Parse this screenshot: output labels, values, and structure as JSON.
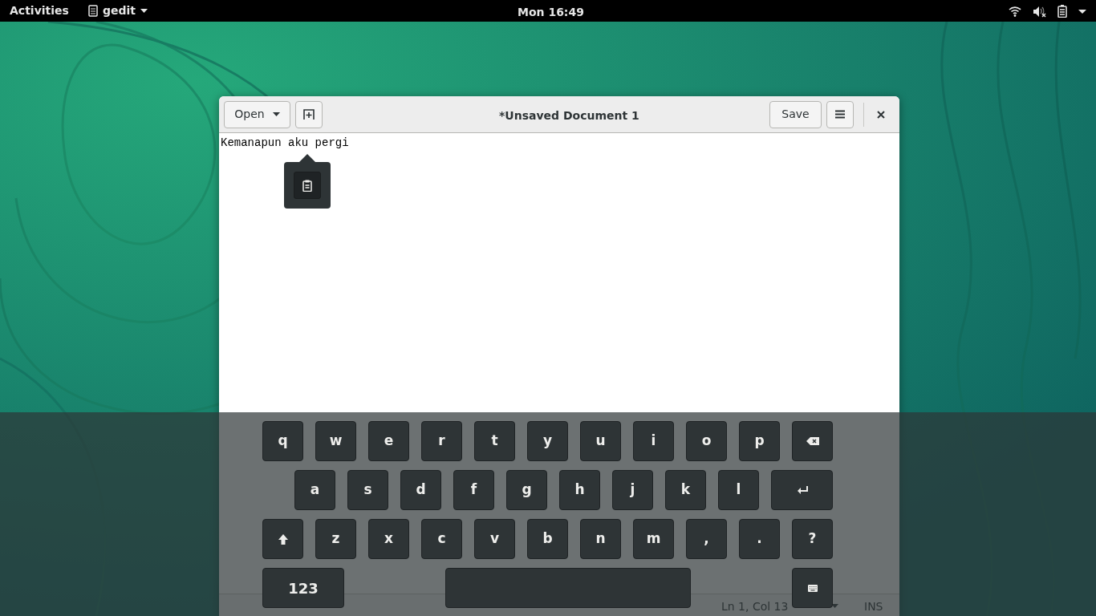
{
  "top_bar": {
    "activities": "Activities",
    "app_menu": "gedit",
    "clock": "Mon 16:49"
  },
  "window": {
    "open_button": "Open",
    "title": "*Unsaved Document 1",
    "save_button": "Save",
    "text": "Kemanapun aku pergi",
    "status_bar": {
      "position": "Ln 1, Col 13",
      "mode": "INS"
    }
  },
  "keyboard": {
    "rows": [
      [
        {
          "kind": "letter",
          "label": "q"
        },
        {
          "kind": "letter",
          "label": "w"
        },
        {
          "kind": "letter",
          "label": "e"
        },
        {
          "kind": "letter",
          "label": "r"
        },
        {
          "kind": "letter",
          "label": "t"
        },
        {
          "kind": "letter",
          "label": "y"
        },
        {
          "kind": "letter",
          "label": "u"
        },
        {
          "kind": "letter",
          "label": "i"
        },
        {
          "kind": "letter",
          "label": "o"
        },
        {
          "kind": "letter",
          "label": "p"
        },
        {
          "kind": "backspace"
        }
      ],
      [
        {
          "kind": "letter",
          "label": "a"
        },
        {
          "kind": "letter",
          "label": "s"
        },
        {
          "kind": "letter",
          "label": "d"
        },
        {
          "kind": "letter",
          "label": "f"
        },
        {
          "kind": "letter",
          "label": "g"
        },
        {
          "kind": "letter",
          "label": "h"
        },
        {
          "kind": "letter",
          "label": "j"
        },
        {
          "kind": "letter",
          "label": "k"
        },
        {
          "kind": "letter",
          "label": "l"
        },
        {
          "kind": "enter"
        }
      ],
      [
        {
          "kind": "shift"
        },
        {
          "kind": "letter",
          "label": "z"
        },
        {
          "kind": "letter",
          "label": "x"
        },
        {
          "kind": "letter",
          "label": "c"
        },
        {
          "kind": "letter",
          "label": "v"
        },
        {
          "kind": "letter",
          "label": "b"
        },
        {
          "kind": "letter",
          "label": "n"
        },
        {
          "kind": "letter",
          "label": "m"
        },
        {
          "kind": "letter",
          "label": ","
        },
        {
          "kind": "letter",
          "label": "."
        },
        {
          "kind": "letter",
          "label": "?"
        }
      ],
      [
        {
          "kind": "numbers",
          "label": "123"
        },
        {
          "kind": "space"
        },
        {
          "kind": "hide"
        }
      ]
    ]
  }
}
